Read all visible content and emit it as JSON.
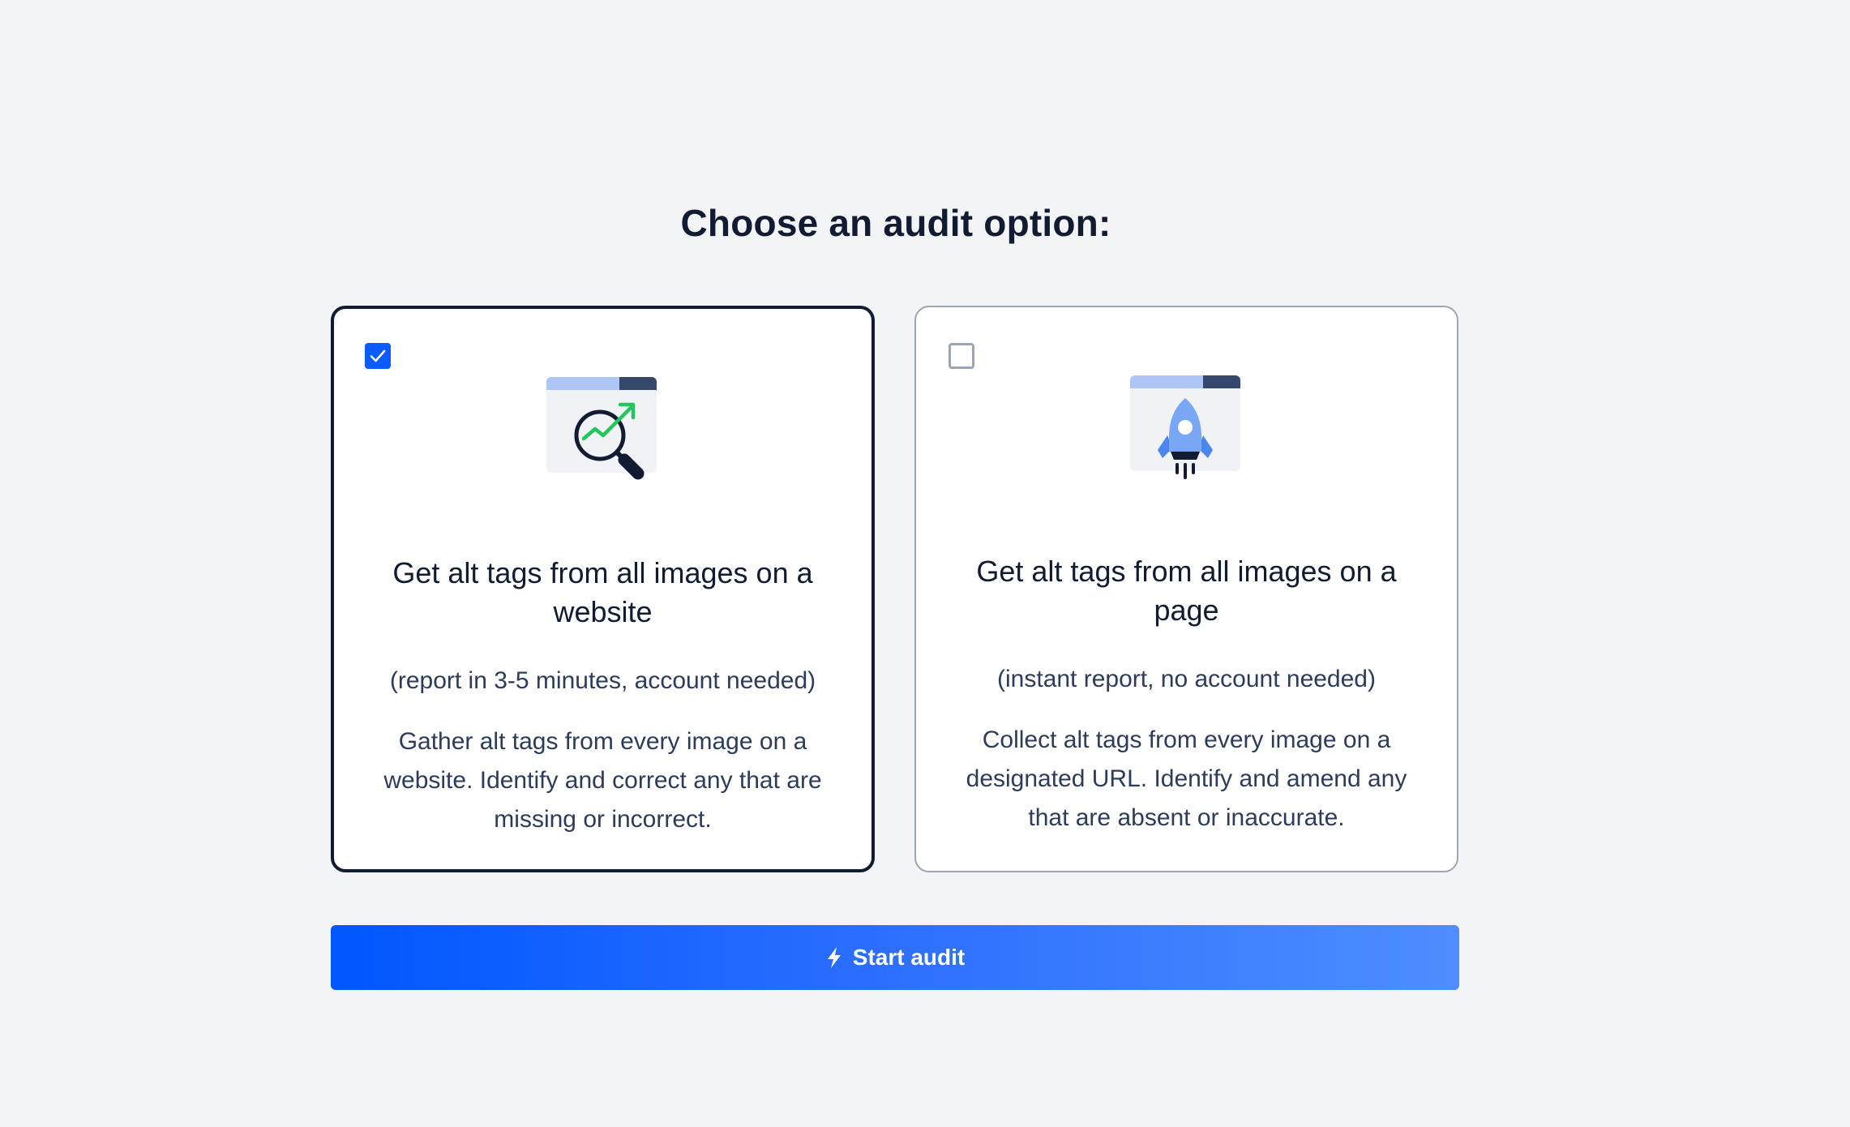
{
  "heading": "Choose an audit option:",
  "options": [
    {
      "checked": true,
      "title": "Get alt tags from all images on a website",
      "subtitle": "(report in 3-5 minutes, account needed)",
      "description": "Gather alt tags from every image on a website. Identify and correct any that are missing or incorrect.",
      "icon": "magnifier-growth-icon"
    },
    {
      "checked": false,
      "title": "Get alt tags from all images on a page",
      "subtitle": "(instant report, no account needed)",
      "description": "Collect alt tags from every image on a designated URL. Identify and amend any that are absent or inaccurate.",
      "icon": "rocket-icon"
    }
  ],
  "start_button": {
    "label": "Start audit",
    "icon": "lightning-bolt-icon"
  },
  "colors": {
    "background": "#f3f4f6",
    "accent": "#0a5cff",
    "selected_border": "#111c33",
    "unselected_border": "#9aa5b6",
    "button_gradient_start": "#0057ff",
    "button_gradient_end": "#4e8dff",
    "growth_arrow": "#22c55e"
  }
}
